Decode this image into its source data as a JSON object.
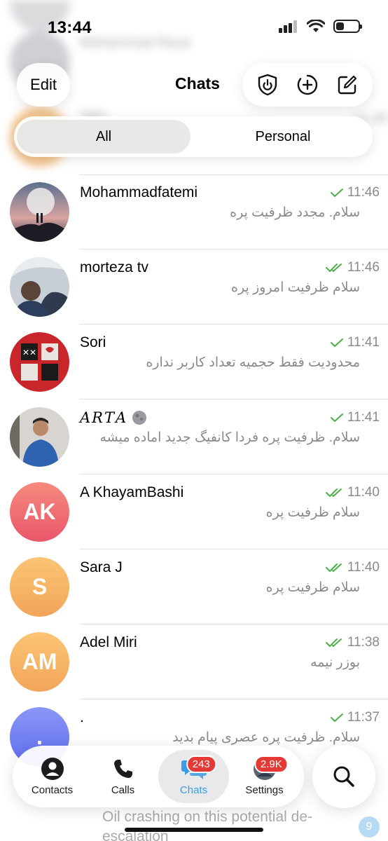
{
  "status": {
    "time": "13:44",
    "battery_level": 0.35
  },
  "ghost_rows": [
    {
      "name": "Mohammad Reza",
      "color": "#e9e4f3"
    },
    {
      "name": "Tahi",
      "time": "11:46",
      "color": "#f2b36a",
      "initial": "T"
    }
  ],
  "nav": {
    "edit": "Edit",
    "title": "Chats"
  },
  "tabs": {
    "all": "All",
    "personal": "Personal"
  },
  "chats": [
    {
      "name": "Mohammadfatemi",
      "preview": "سلام. مجدد ظرفیت پره",
      "time": "11:46",
      "status": "sent"
    },
    {
      "name": "morteza tv",
      "preview": "سلام ظرفیت امروز پره",
      "time": "11:46",
      "status": "read"
    },
    {
      "name": "Sori",
      "preview": "محدودیت فقط حجمیه تعداد کاربر نداره",
      "time": "11:41",
      "status": "sent"
    },
    {
      "name": "𝐴𝑅𝑇𝐴",
      "preview": "سلام. ظرفیت پره فردا کانفیگ جدید اماده میشه",
      "time": "11:41",
      "status": "sent"
    },
    {
      "name": "A KhayamBashi",
      "initials": "AK",
      "preview": "سلام ظرفیت پره",
      "time": "11:40",
      "status": "read",
      "color_top": "#f68a7d",
      "color_bottom": "#e9566a"
    },
    {
      "name": "Sara J",
      "initials": "S",
      "preview": "سلام ظرفیت پره",
      "time": "11:40",
      "status": "read",
      "color_top": "#fbc474",
      "color_bottom": "#f2a55a"
    },
    {
      "name": "Adel Miri",
      "initials": "AM",
      "preview": "بوزر نیمه",
      "time": "11:38",
      "status": "read",
      "color_top": "#fbc474",
      "color_bottom": "#f2a55a"
    },
    {
      "name": ".",
      "initials": ".",
      "preview": "سلام. ظرفیت پره عصری پیام بدید",
      "time": "11:37",
      "status": "sent",
      "color_top": "#8b97f5",
      "color_bottom": "#5f6cf0"
    }
  ],
  "bottom_ghost": {
    "preview": "Oil crashing on this potential de-escalation",
    "unread": "9"
  },
  "tabbar": {
    "contacts": "Contacts",
    "calls": "Calls",
    "chats": "Chats",
    "chats_badge": "243",
    "settings": "Settings",
    "settings_badge": "2.9K"
  },
  "colors": {
    "accent": "#3b9de2",
    "check": "#4cb04a",
    "badge": "#e53935"
  }
}
